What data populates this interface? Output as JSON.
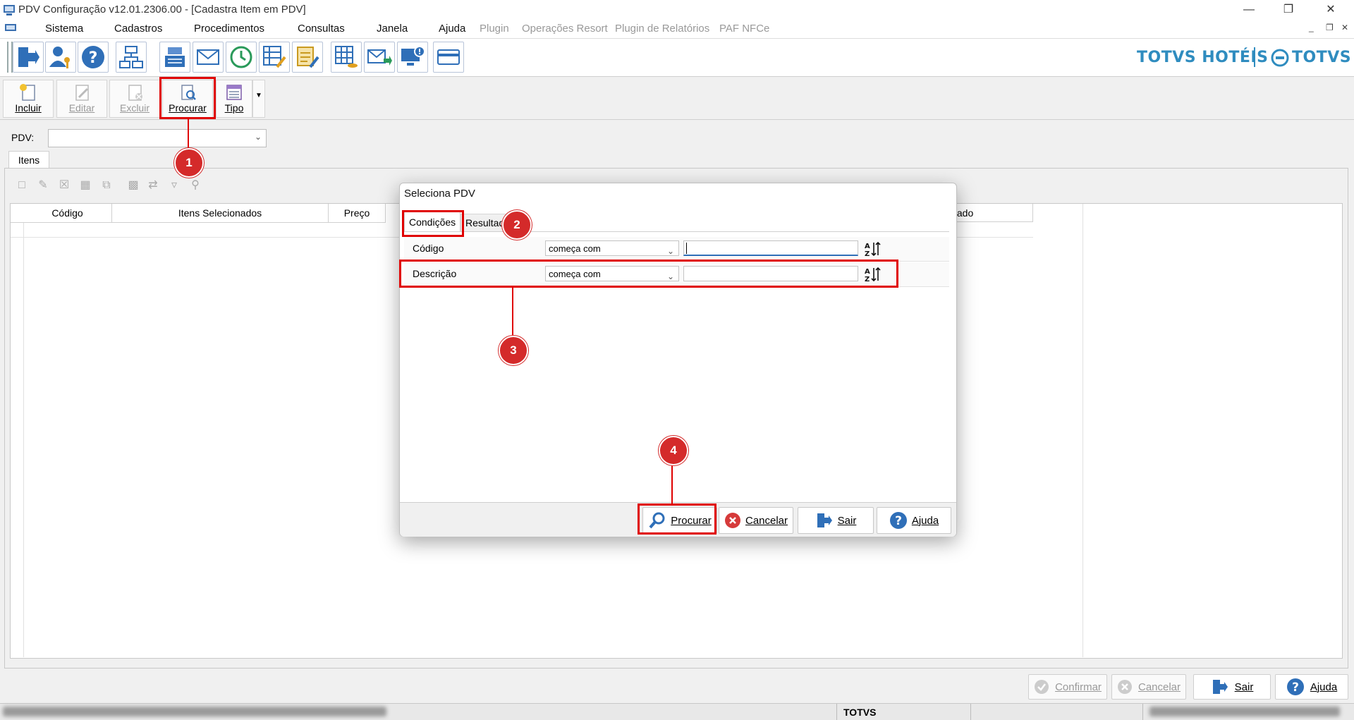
{
  "window": {
    "title": "PDV Configuração v12.01.2306.00 - [Cadastra Item em PDV]"
  },
  "menu": {
    "items": [
      "Sistema",
      "Cadastros",
      "Procedimentos",
      "Consultas",
      "Janela",
      "Ajuda"
    ],
    "plugins": [
      "Plugin",
      "Operações Resort",
      "Plugin de Relatórios",
      "PAF NFCe"
    ]
  },
  "brand": {
    "left": "TOTVS HOTÉIS",
    "right": "TOTVS",
    "color": "#2f8cbf"
  },
  "actions": {
    "incluir": "Incluir",
    "editar": "Editar",
    "excluir": "Excluir",
    "procurar": "Procurar",
    "tipo": "Tipo"
  },
  "main": {
    "pdv_label": "PDV:",
    "pdv_value": "",
    "tab_itens": "Itens",
    "columns": [
      "Código",
      "Itens Selecionados",
      "Preço",
      "moxarifado"
    ]
  },
  "dialog": {
    "title": "Seleciona PDV",
    "tabs": [
      "Condições",
      "Resultado"
    ],
    "conditions": [
      {
        "label": "Código",
        "operator": "começa com",
        "value": ""
      },
      {
        "label": "Descrição",
        "operator": "começa com",
        "value": ""
      }
    ],
    "buttons": {
      "procurar": "Procurar",
      "cancelar": "Cancelar",
      "sair": "Sair",
      "ajuda": "Ajuda"
    }
  },
  "bottom": {
    "confirmar": "Confirmar",
    "cancelar": "Cancelar",
    "sair": "Sair",
    "ajuda": "Ajuda"
  },
  "status": {
    "center": "TOTVS"
  },
  "annotations": [
    "1",
    "2",
    "3",
    "4"
  ],
  "colors": {
    "highlight": "#e00000",
    "marker": "#d42a2a",
    "accent": "#2f6fb8"
  }
}
